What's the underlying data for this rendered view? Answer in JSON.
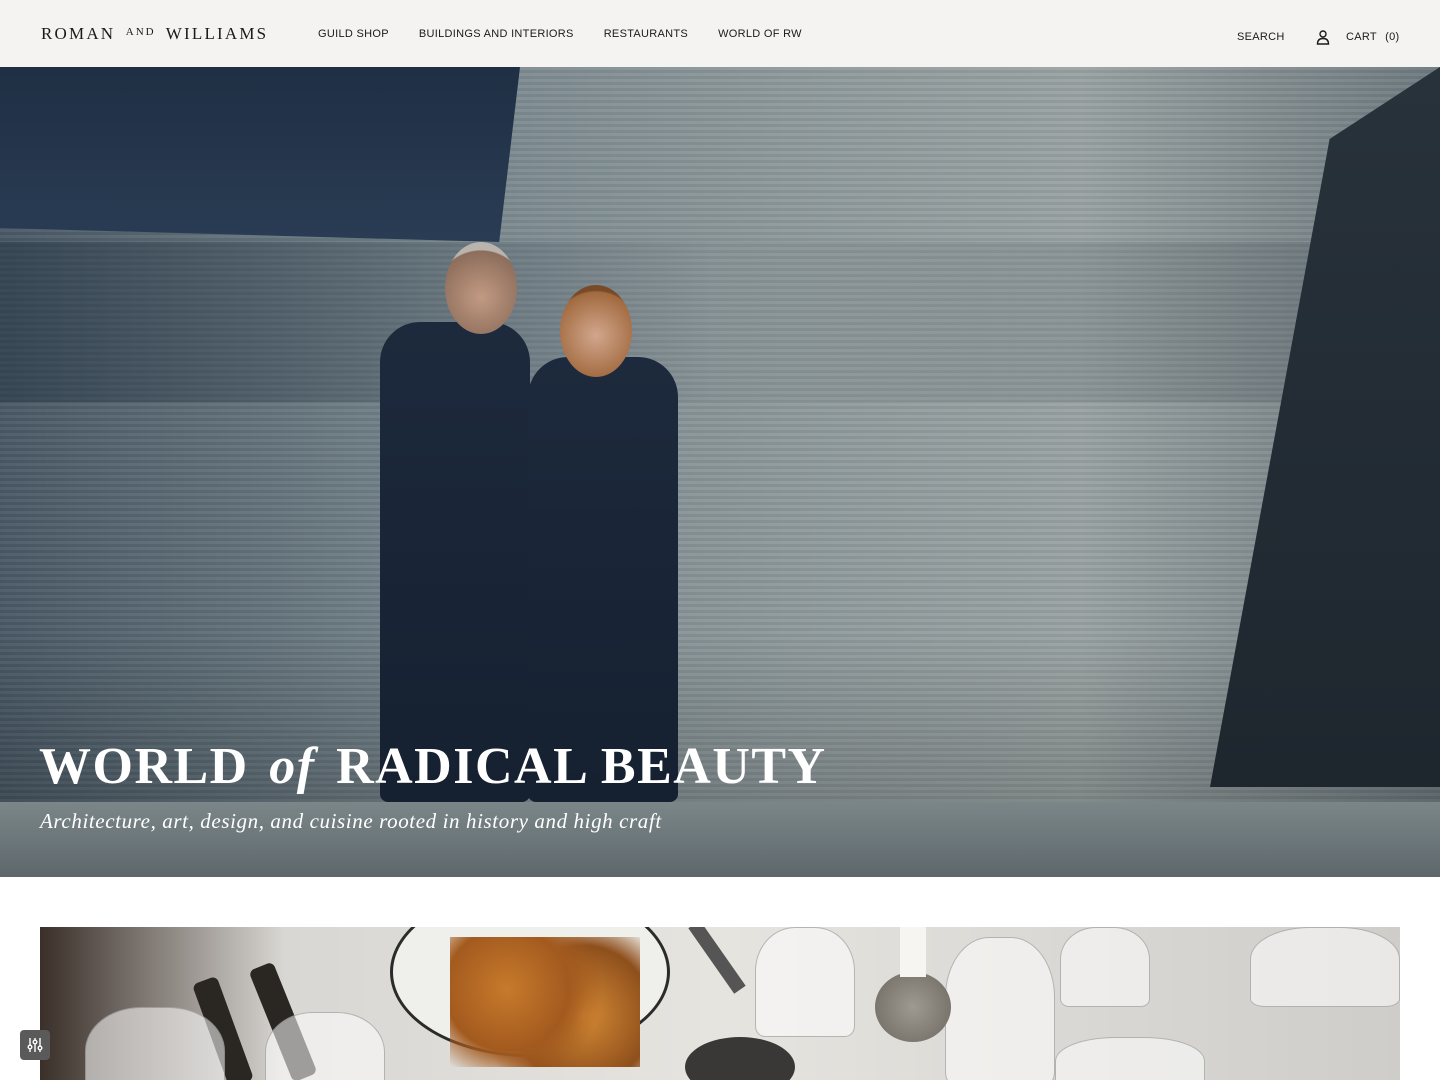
{
  "header": {
    "logo": {
      "part1": "ROMAN",
      "part2": "AND",
      "part3": "WILLIAMS"
    },
    "nav": [
      {
        "label": "GUILD SHOP"
      },
      {
        "label": "BUILDINGS AND INTERIORS"
      },
      {
        "label": "RESTAURANTS"
      },
      {
        "label": "WORLD OF RW"
      }
    ],
    "search_label": "SEARCH",
    "account_icon": "user-icon",
    "cart_label": "CART",
    "cart_count": "(0)"
  },
  "hero": {
    "title_part1": "WORLD",
    "title_italic": "of",
    "title_part2": "RADICAL BEAUTY",
    "subtitle": "Architecture, art, design, and cuisine rooted in history and high craft"
  },
  "settings_icon": "sliders-icon",
  "colors": {
    "header_bg": "#f4f3f1",
    "hero_text": "#ffffff",
    "text": "#1a1a1a"
  }
}
